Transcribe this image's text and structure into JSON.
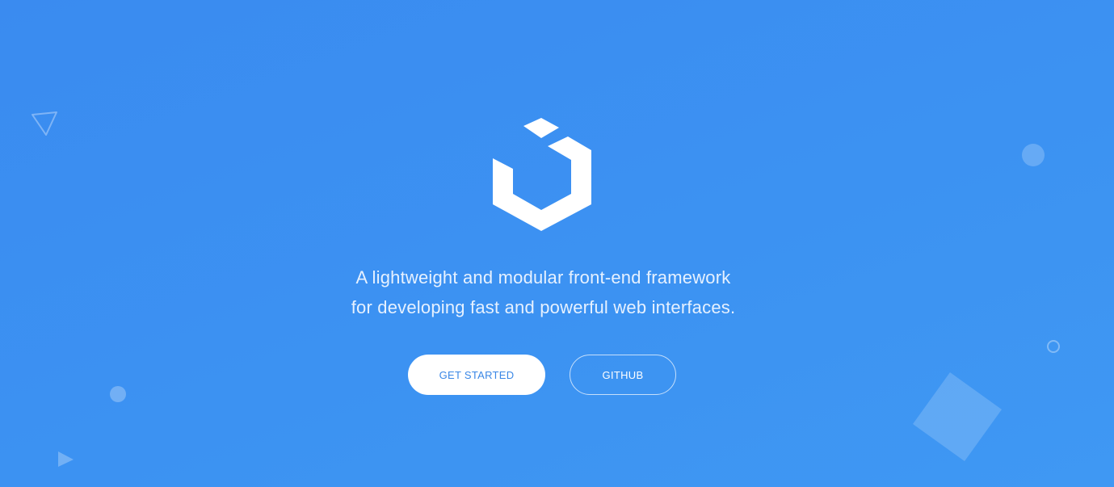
{
  "hero": {
    "logo_icon": "uikit-logo-icon",
    "tagline_line1": "A lightweight and modular front-end framework",
    "tagline_line2": "for developing fast and powerful web interfaces.",
    "primary_button": "GET STARTED",
    "secondary_button": "GITHUB"
  },
  "decorations": [
    "triangle-outline-icon",
    "circle-filled-icon",
    "circle-filled-small-icon",
    "play-triangle-icon",
    "circle-outline-icon",
    "square-rotated-icon"
  ],
  "colors": {
    "background": "#3c8ff2",
    "button_primary_bg": "#ffffff",
    "button_primary_text": "#3a87e6",
    "text": "#e6f1ff"
  }
}
